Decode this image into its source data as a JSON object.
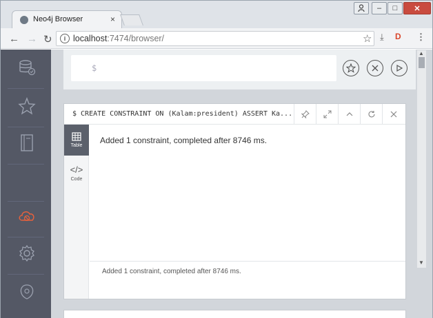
{
  "browser": {
    "tab_title": "Neo4j Browser",
    "tab_close": "×",
    "url_host": "localhost",
    "url_rest": ":7474/browser/",
    "window_buttons": {
      "minimize": "–",
      "maximize": "□",
      "close": "✕"
    },
    "icons": [
      "page-icon",
      "user-icon",
      "back-icon",
      "forward-icon",
      "reload-icon",
      "info-icon",
      "star-icon",
      "download-icon",
      "extension-icon",
      "menu-icon"
    ]
  },
  "editor": {
    "prompt": "$"
  },
  "frame": {
    "command": "$ CREATE CONSTRAINT ON (Kalam:president) ASSERT Ka...",
    "result": "Added 1 constraint, completed after 8746 ms.",
    "status": "Added 1 constraint, completed after 8746 ms.",
    "views": [
      {
        "label": "Table",
        "icon": "table-icon"
      },
      {
        "label": "Code",
        "icon": "code-icon"
      }
    ]
  },
  "sidebar": {
    "items": [
      "database-icon",
      "favorites-star-icon",
      "documents-book-icon",
      "cloud-sync-icon",
      "settings-gear-icon",
      "about-icon"
    ]
  },
  "colors": {
    "sidebar_bg": "#545865",
    "accent_orange": "#e8613c",
    "active_view": "#5b606b"
  }
}
